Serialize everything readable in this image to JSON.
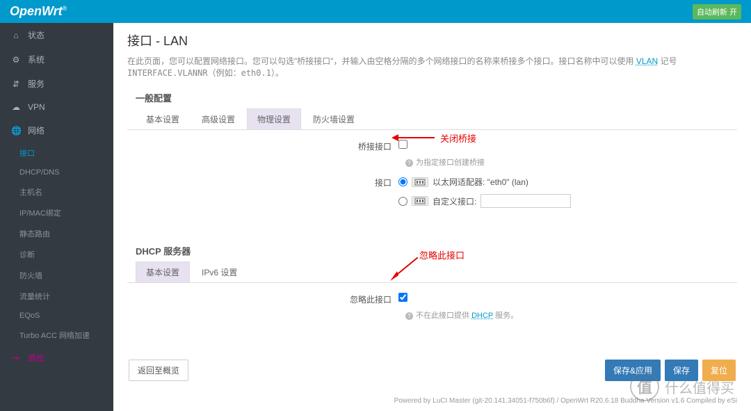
{
  "header": {
    "brand": "OpenWrt",
    "brand_sup": "®",
    "autorefresh": "自动刷新 开"
  },
  "sidebar": {
    "items": [
      {
        "icon": "⌂",
        "label": "状态"
      },
      {
        "icon": "⚙",
        "label": "系统"
      },
      {
        "icon": "⇵",
        "label": "服务"
      },
      {
        "icon": "☁",
        "label": "VPN"
      },
      {
        "icon": "🌐",
        "label": "网络"
      }
    ],
    "subitems": [
      "接口",
      "DHCP/DNS",
      "主机名",
      "IP/MAC绑定",
      "静态路由",
      "诊断",
      "防火墙",
      "流量统计",
      "EQoS",
      "Turbo ACC 网络加速"
    ],
    "logout": {
      "icon": "↪",
      "label": "退出"
    }
  },
  "page": {
    "title": "接口 - LAN",
    "desc_p1": "在此页面，您可以配置网络接口。您可以勾选\"桥接接口\"，并输入由空格分隔的多个网络接口的名称来桥接多个接口。接口名称中可以使用 ",
    "desc_vlan": "VLAN",
    "desc_p2": " 记号 ",
    "desc_code": "INTERFACE.VLANNR",
    "desc_p3": "（例如：",
    "desc_eth": "eth0.1",
    "desc_p4": "）。"
  },
  "section1": {
    "title": "一般配置",
    "tabs": [
      "基本设置",
      "高级设置",
      "物理设置",
      "防火墙设置"
    ],
    "bridge_label": "桥接接口",
    "bridge_help": "为指定接口创建桥接",
    "iface_label": "接口",
    "eth_text": "以太网适配器: \"eth0\" (lan)",
    "custom_label": "自定义接口:"
  },
  "section2": {
    "title": "DHCP 服务器",
    "tabs": [
      "基本设置",
      "IPv6 设置"
    ],
    "ignore_label": "忽略此接口",
    "ignore_help_pre": "不在此接口提供 ",
    "ignore_help_link": "DHCP",
    "ignore_help_post": " 服务。"
  },
  "actions": {
    "back": "返回至概览",
    "save_apply": "保存&应用",
    "save": "保存",
    "reset": "复位"
  },
  "footer": "Powered by LuCI Master (git-20.141.34051-f750b6f) / OpenWrt R20.6.18 Buddha Version v1.6 Compiled by eSi",
  "annot": {
    "a1": "关闭桥接",
    "a2": "忽略此接口"
  },
  "watermark": {
    "char": "值",
    "text": "什么值得买"
  }
}
